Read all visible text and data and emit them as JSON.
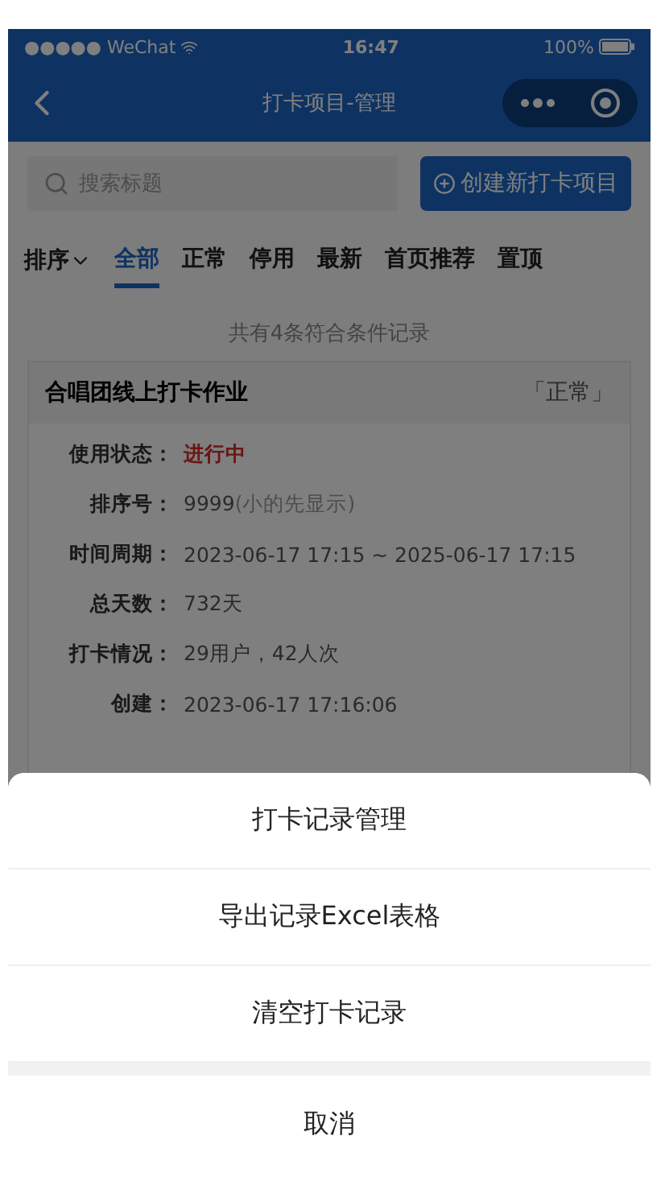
{
  "status_bar": {
    "carrier": "●●●●● WeChat",
    "time": "16:47",
    "battery": "100%"
  },
  "nav": {
    "title": "打卡项目-管理"
  },
  "search": {
    "placeholder": "搜索标题"
  },
  "create_button": {
    "label": "创建新打卡项目"
  },
  "sort": {
    "label": "排序"
  },
  "tabs": [
    {
      "label": "全部",
      "selected": true
    },
    {
      "label": "正常",
      "selected": false
    },
    {
      "label": "停用",
      "selected": false
    },
    {
      "label": "最新",
      "selected": false
    },
    {
      "label": "首页推荐",
      "selected": false
    },
    {
      "label": "置顶",
      "selected": false
    }
  ],
  "result_count": "共有4条符合条件记录",
  "card": {
    "title": "合唱团线上打卡作业",
    "status_tag": "「正常」",
    "fields": [
      {
        "label": "使用状态：",
        "value": "进行中",
        "kind": "status"
      },
      {
        "label": "排序号：",
        "value": "9999",
        "note": "(小的先显示)",
        "kind": "plain"
      },
      {
        "label": "时间周期：",
        "value": "2023-06-17 17:15 ~ 2025-06-17 17:15",
        "kind": "plain"
      },
      {
        "label": "总天数：",
        "value": "732天",
        "kind": "plain"
      },
      {
        "label": "打卡情况：",
        "value": "29用户，42人次",
        "kind": "plain"
      },
      {
        "label": "创建：",
        "value": "2023-06-17 17:16:06",
        "kind": "plain"
      }
    ]
  },
  "action_sheet": {
    "items": [
      "打卡记录管理",
      "导出记录Excel表格",
      "清空打卡记录"
    ],
    "cancel": "取消"
  }
}
